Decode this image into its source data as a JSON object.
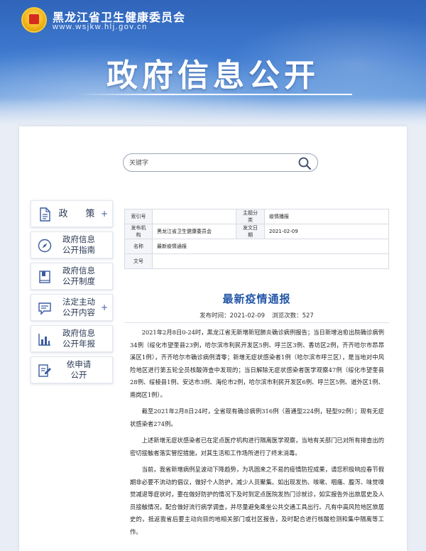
{
  "header": {
    "site_name": "黑龙江省卫生健康委员会",
    "site_url": "www.wsjkw.hlj.gov.cn",
    "page_heading": "政府信息公开"
  },
  "search": {
    "placeholder": "关键字"
  },
  "sidebar": {
    "items": [
      {
        "line1": "政　策",
        "line2": "",
        "icon": "document-icon",
        "has_plus": true
      },
      {
        "line1": "政府信息",
        "line2": "公开指南",
        "icon": "compass-icon",
        "has_plus": false
      },
      {
        "line1": "政府信息",
        "line2": "公开制度",
        "icon": "book-icon",
        "has_plus": false
      },
      {
        "line1": "法定主动",
        "line2": "公开内容",
        "icon": "chat-icon",
        "has_plus": true
      },
      {
        "line1": "政府信息",
        "line2": "公开年报",
        "icon": "chart-icon",
        "has_plus": false
      },
      {
        "line1": "依申请",
        "line2": "公开",
        "icon": "edit-icon",
        "has_plus": false
      }
    ],
    "plus_symbol": "+"
  },
  "meta": {
    "index_label": "索引号",
    "index_value": "",
    "topic_label": "主题分类",
    "topic_value": "疫情播报",
    "publisher_label": "发布机构",
    "publisher_value": "黑龙江省卫生健康委员会",
    "date_label": "发文日期",
    "date_value": "2021-02-09",
    "name_label": "名称",
    "name_value": "最新疫情通报",
    "docno_label": "文号",
    "docno_value": ""
  },
  "article": {
    "title": "最新疫情通报",
    "publish_label": "发布时间：",
    "publish_time": "2021-02-09",
    "views_label": "浏览次数：",
    "views": "527",
    "paragraphs": [
      "2021年2月8日0-24时，黑龙江省无新增新冠肺炎确诊病例报告；当日新增治愈出院确诊病例34例（绥化市望奎县23例，哈尔滨市利民开发区5例、呼兰区3例、香坊区2例，齐齐哈尔市昂昂溪区1例），齐齐哈尔市确诊病例清零；新增无症状感染者1例（哈尔滨市呼兰区），是当地对中风险地区进行第五轮全员核酸筛查中发现的；当日解除无症状感染者医学观察47例（绥化市望奎县28例、绥棱县1例、安达市3例、海伦市2例，哈尔滨市利民开发区6例、呼兰区5例、道外区1例、南岗区1例）。",
      "截至2021年2月8日24时，全省现有确诊病例316例（普通型224例，轻型92例）；现有无症状感染者274例。",
      "上述新增无症状感染者已在定点医疗机构进行隔离医学观察，当地有关部门已对所有排查出的密切接触者落实管控措施，对其生活和工作场所进行了终末消毒。",
      "当前，我省新增病例呈波动下降趋势，为巩固来之不易的疫情防控成果，请您积极响应春节假期非必要不流动的倡议，做好个人防护，减少人员聚集。如出现发热、咳嗽、咽痛、腹泻、味觉嗅觉减退等症状时，要在做好防护的情况下及时到定点医院发热门诊就诊，如实报告外出旅居史及人员接触情况，配合做好流行病学调查，并尽量避免乘坐公共交通工具出行。凡有中高风险地区旅居史的，抵返我省后要主动向目的地相关部门或社区报告，及时配合进行核酸检测和集中隔离等工作。"
    ]
  },
  "colors": {
    "banner_top": "#2f64ba",
    "title_blue": "#2356a8",
    "icon_blue": "#3a5aa0"
  }
}
